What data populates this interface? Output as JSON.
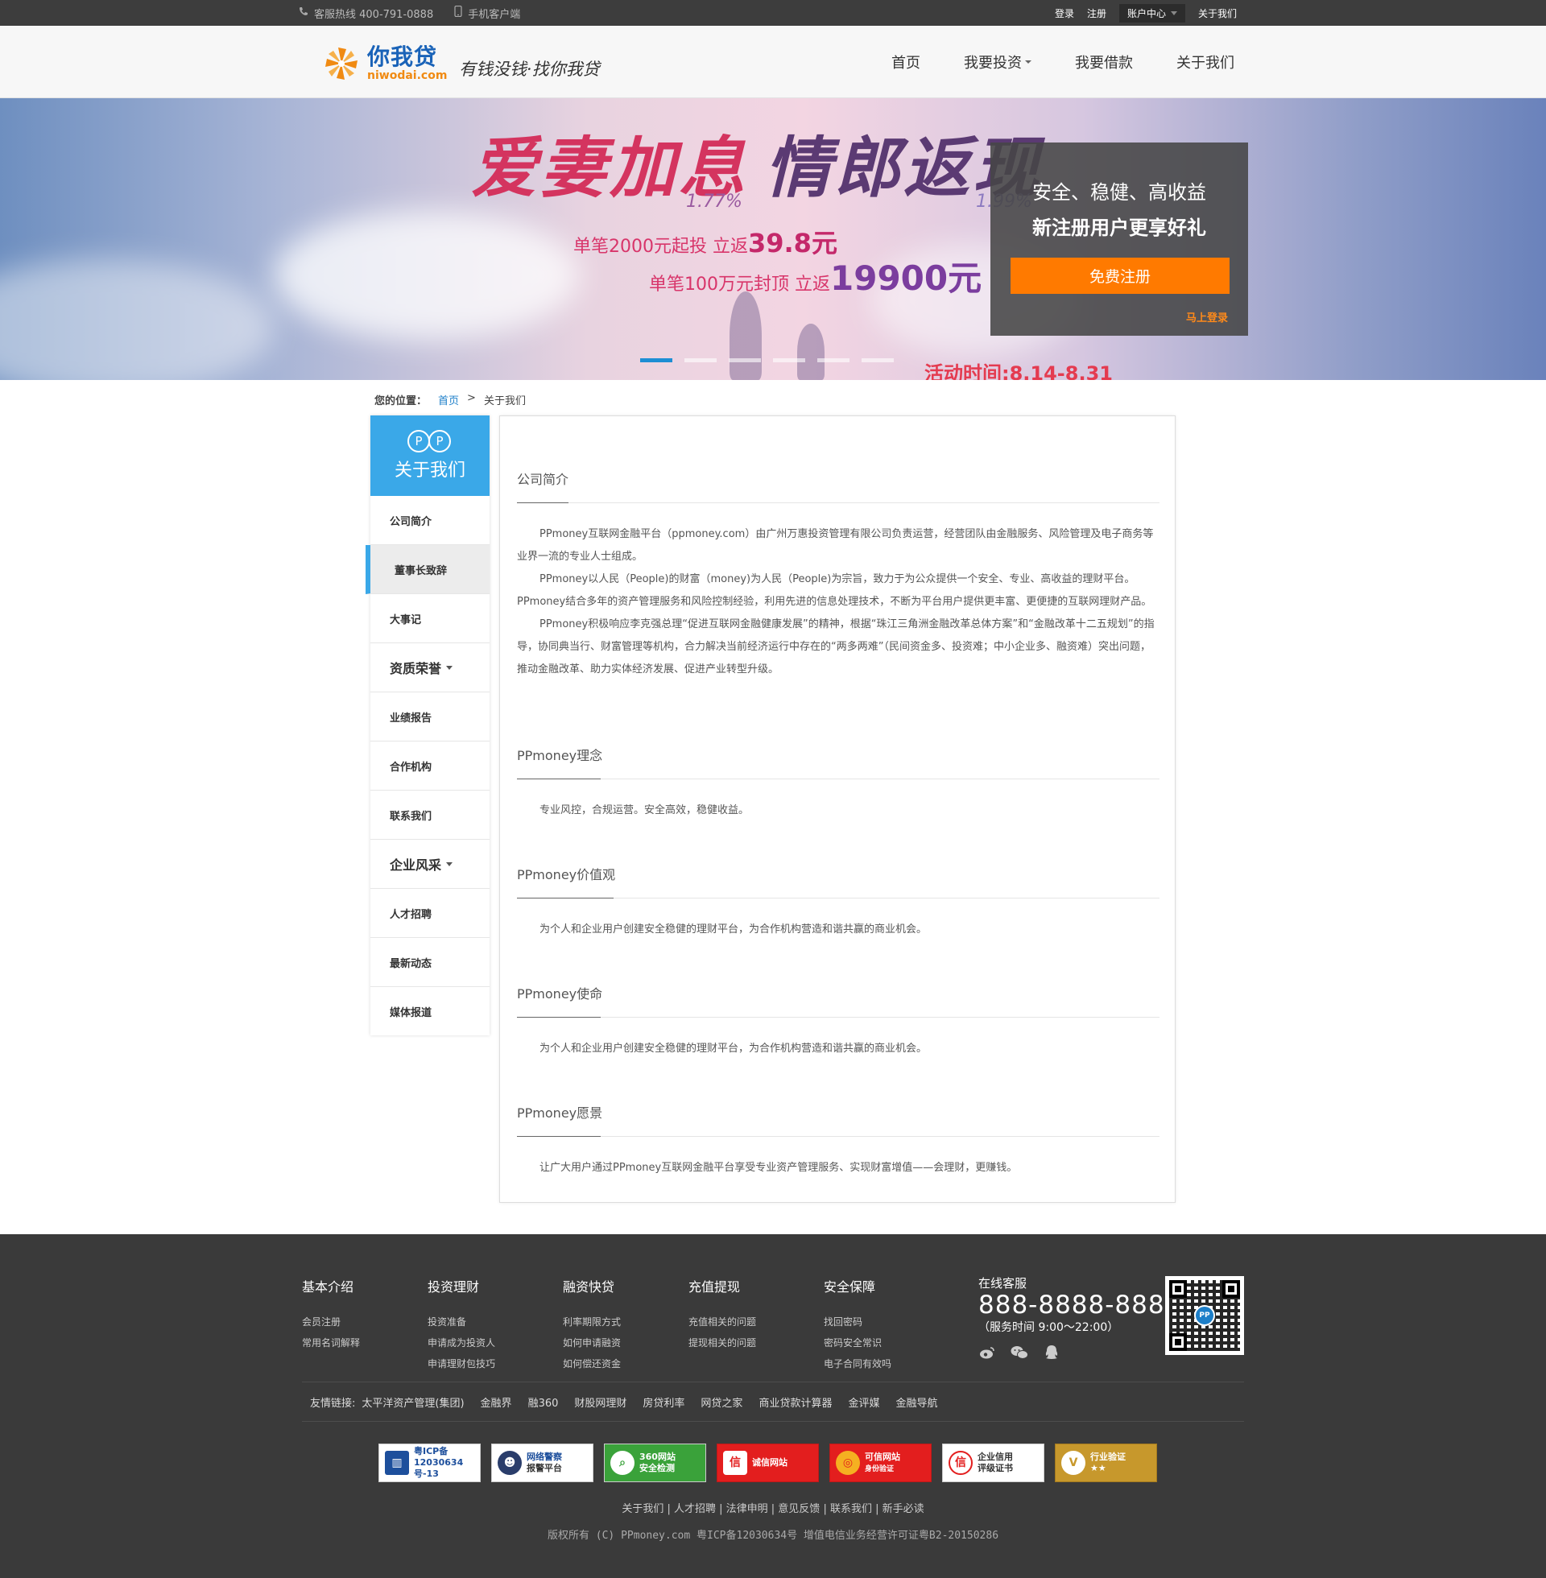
{
  "topbar": {
    "hotline": "客服热线 400-791-0888",
    "mobile": "手机客户端",
    "login": "登录",
    "register": "注册",
    "account": "账户中心",
    "about": "关于我们"
  },
  "header": {
    "logo_cn": "你我贷",
    "logo_en": "niwodai.com",
    "slogan": "有钱没钱·找你我贷",
    "nav": [
      "首页",
      "我要投资",
      "我要借款",
      "关于我们"
    ]
  },
  "banner": {
    "title1": "爱妻加息",
    "title2": "情郎返现",
    "rate1": "1.77%",
    "rate2": "1.99%",
    "line1_prefix": "单笔2000元起投  立返",
    "line1_amount": "39.8元",
    "line2_prefix": "单笔100万元封顶  立返",
    "line2_amount": "19900元",
    "period": "活动时间:8.14-8.31",
    "reg_line1": "安全、稳健、高收益",
    "reg_line2": "新注册用户更享好礼",
    "reg_button": "免费注册",
    "login_link": "马上登录"
  },
  "breadcrumb": {
    "label": "您的位置：",
    "home": "首页",
    "sep": ">",
    "current": "关于我们"
  },
  "sidebar": {
    "logo": "PP",
    "title": "关于我们",
    "items": [
      {
        "label": "公司简介"
      },
      {
        "label": "董事长致辞"
      },
      {
        "label": "大事记"
      },
      {
        "label": "资质荣誉"
      },
      {
        "label": "业绩报告"
      },
      {
        "label": "合作机构"
      },
      {
        "label": "联系我们"
      },
      {
        "label": "企业风采"
      },
      {
        "label": "人才招聘"
      },
      {
        "label": "最新动态"
      },
      {
        "label": "媒体报道"
      }
    ]
  },
  "content": {
    "intro_title": "公司简介",
    "intro_p1": "PPmoney互联网金融平台（ppmoney.com）由广州万惠投资管理有限公司负责运营，经营团队由金融服务、风险管理及电子商务等业界一流的专业人士组成。",
    "intro_p2": "PPmoney以人民（People)的财富（money)为人民（People)为宗旨，致力于为公众提供一个安全、专业、高收益的理财平台。PPmoney结合多年的资产管理服务和风险控制经验，利用先进的信息处理技术，不断为平台用户提供更丰富、更便捷的互联网理财产品。",
    "intro_p3": "PPmoney积极响应李克强总理“促进互联网金融健康发展”的精神，根据“珠江三角洲金融改革总体方案”和“金融改革十二五规划”的指导，协同典当行、财富管理等机构，合力解决当前经济运行中存在的“两多两难”（民间资金多、投资难；中小企业多、融资难）突出问题，推动金融改革、助力实体经济发展、促进产业转型升级。",
    "concept_title": "PPmoney理念",
    "concept_text": "专业风控，合规运营。安全高效，稳健收益。",
    "values_title": "PPmoney价值观",
    "values_text": "为个人和企业用户创建安全稳健的理财平台，为合作机构营造和谐共赢的商业机会。",
    "mission_title": "PPmoney使命",
    "mission_text": "为个人和企业用户创建安全稳健的理财平台，为合作机构营造和谐共赢的商业机会。",
    "vision_title": "PPmoney愿景",
    "vision_text": "让广大用户通过PPmoney互联网金融平台享受专业资产管理服务、实现财富增值——会理财，更赚钱。"
  },
  "footer": {
    "columns": [
      {
        "title": "基本介绍",
        "links": [
          "会员注册",
          "常用名词解释"
        ]
      },
      {
        "title": "投资理财",
        "links": [
          "投资准备",
          "申请成为投资人",
          "申请理财包技巧"
        ]
      },
      {
        "title": "融资快贷",
        "links": [
          "利率期限方式",
          "如何申请融资",
          "如何偿还资金"
        ]
      },
      {
        "title": "充值提现",
        "links": [
          "充值相关的问题",
          "提现相关的问题"
        ]
      },
      {
        "title": "安全保障",
        "links": [
          "找回密码",
          "密码安全常识",
          "电子合同有效吗"
        ]
      }
    ],
    "service_title": "在线客服",
    "service_phone": "888-8888-888",
    "service_hours": "（服务时间 9:00～22:00）",
    "qr_logo": "PP",
    "friend_links_label": "友情链接:",
    "friend_links": [
      "太平洋资产管理(集团)",
      "金融界",
      "融360",
      "财股网理财",
      "房贷利率",
      "网贷之家",
      "商业贷款计算器",
      "金评媒",
      "金融导航"
    ],
    "badges": [
      {
        "line1": "粤ICP备",
        "line2": "12030634号-13"
      },
      {
        "line1": "网络警察",
        "line2": "报警平台"
      },
      {
        "line1": "360网站",
        "line2": "安全检测"
      },
      {
        "line1": "诚信网站",
        "line2": ""
      },
      {
        "line1": "可信网站",
        "line2": "身份验证"
      },
      {
        "line1": "企业信用",
        "line2": "评级证书"
      },
      {
        "line1": "行业验证",
        "line2": "★★"
      }
    ],
    "bottom_links": "关于我们 | 人才招聘 | 法律申明 | 意见反馈 | 联系我们 | 新手必读",
    "copyright": "版权所有 (C) PPmoney.com 粤ICP备12030634号 增值电信业务经营许可证粤B2-20150286"
  }
}
